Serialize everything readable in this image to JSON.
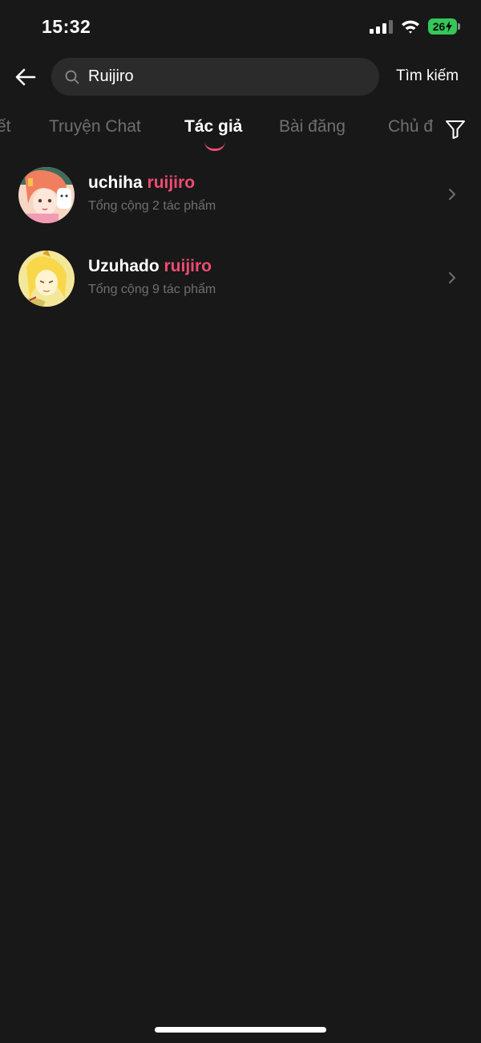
{
  "status_bar": {
    "time": "15:32",
    "battery": "26",
    "battery_color": "#34c759",
    "icons": [
      "signal-icon",
      "wifi-icon",
      "battery-charging-icon"
    ]
  },
  "search": {
    "value": "Ruijiro",
    "submit_label": "Tìm kiếm",
    "icons": [
      "back-arrow-icon",
      "search-icon"
    ]
  },
  "tabs": [
    {
      "label": "ết",
      "active": false
    },
    {
      "label": "Truyện Chat",
      "active": false
    },
    {
      "label": "Tác giả",
      "active": true
    },
    {
      "label": "Bài đăng",
      "active": false
    },
    {
      "label": "Chủ đ",
      "active": false
    }
  ],
  "filter_icon": "filter-icon",
  "results": [
    {
      "name_prefix": "uchiha ",
      "name_highlight": "ruijiro",
      "subtitle": "Tổng cộng 2 tác phẩm",
      "avatar": "avatar-anime-girl-with-cat"
    },
    {
      "name_prefix": "Uzuhado ",
      "name_highlight": "ruijiro",
      "subtitle": "Tổng cộng 9 tác phẩm",
      "avatar": "avatar-anime-girl-yellow"
    }
  ],
  "colors": {
    "background": "#181818",
    "accent": "#ee4b72",
    "muted_text": "#6f6f6f",
    "search_bg": "#2b2b2b"
  }
}
